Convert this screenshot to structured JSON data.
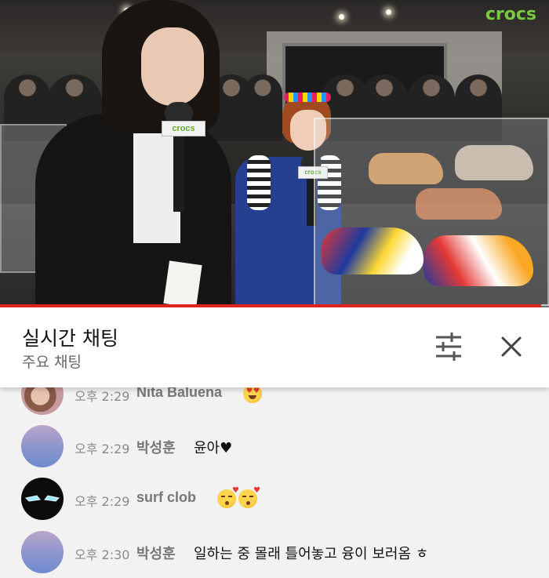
{
  "video": {
    "brand": "crocs",
    "mic_flag": "crocs",
    "progress": 0.986,
    "progress_color": "#e0261e",
    "brand_color": "#7ac943"
  },
  "chat": {
    "title": "실시간 채팅",
    "subtitle": "주요 채팅",
    "filter_icon": "sliders-icon",
    "close_icon": "close-icon"
  },
  "messages": [
    {
      "time": "오후 2:29",
      "author": "Nita Baluena",
      "text": "",
      "emoji": [
        "heart-eyes-emoji"
      ],
      "avatar": "photo"
    },
    {
      "time": "오후 2:29",
      "author": "박성훈",
      "text": "윤아♥",
      "emoji": [],
      "avatar": "gradient"
    },
    {
      "time": "오후 2:29",
      "author": "surf clob",
      "text": "",
      "emoji": [
        "kissing-heart-emoji",
        "kissing-heart-emoji"
      ],
      "avatar": "ironman"
    },
    {
      "time": "오후 2:30",
      "author": "박성훈",
      "text": "일하는 중 몰래 틀어놓고 융이 보러옴 ㅎ",
      "emoji": [],
      "avatar": "gradient"
    }
  ]
}
